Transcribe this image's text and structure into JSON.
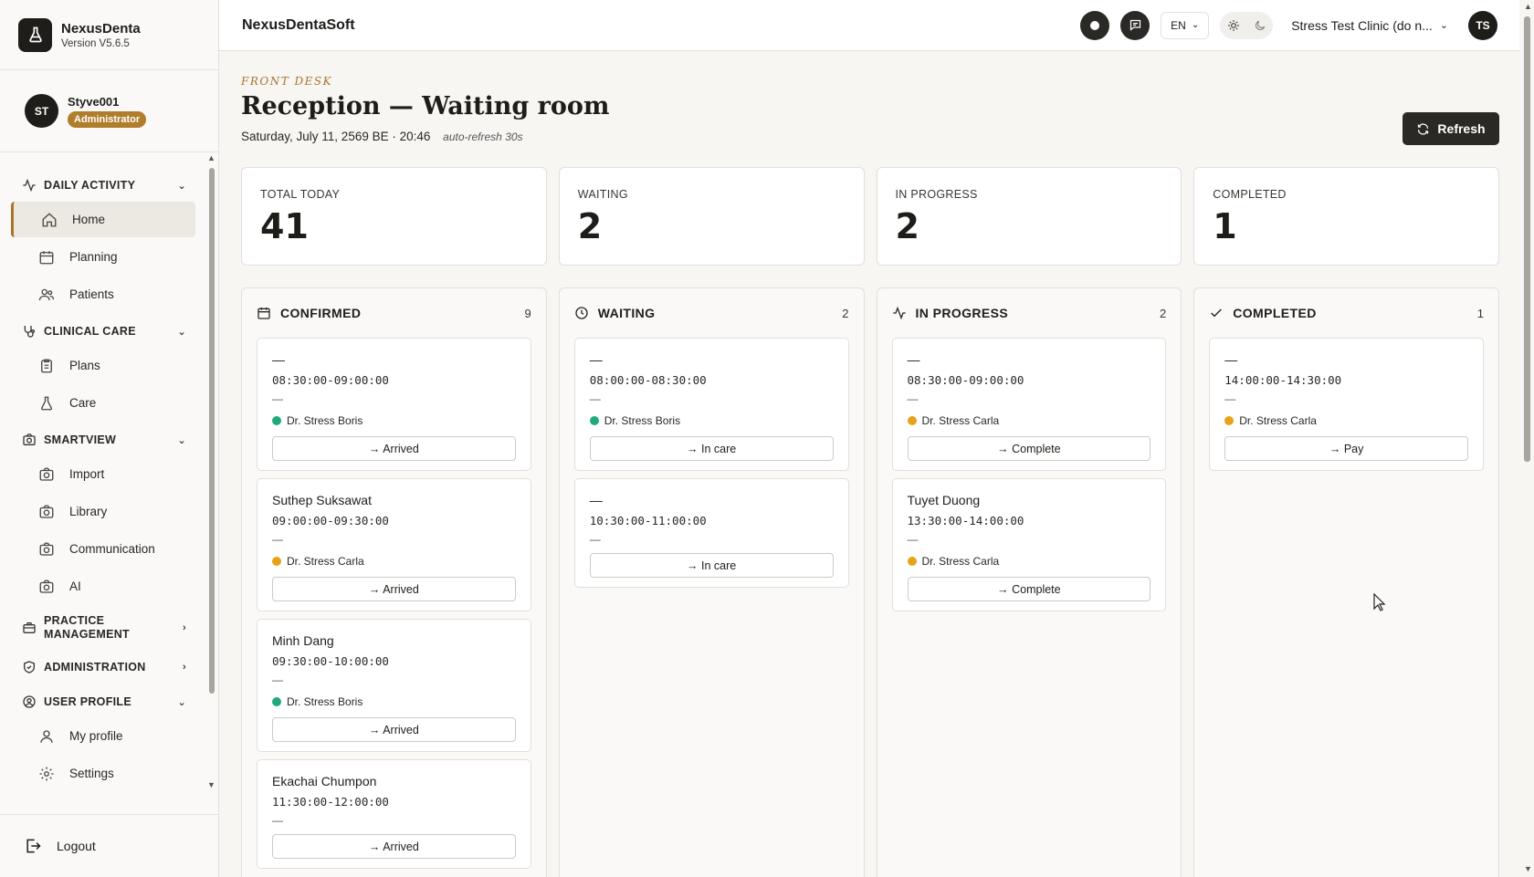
{
  "brand": {
    "name": "NexusDenta",
    "version": "Version V5.6.5"
  },
  "user": {
    "initials": "ST",
    "name": "Styve001",
    "role": "Administrator"
  },
  "nav": {
    "daily_activity": "DAILY ACTIVITY",
    "home": "Home",
    "planning": "Planning",
    "patients": "Patients",
    "clinical_care": "CLINICAL CARE",
    "plans": "Plans",
    "care": "Care",
    "smartview": "SMARTVIEW",
    "import": "Import",
    "library": "Library",
    "communication": "Communication",
    "ai": "AI",
    "practice_management": "PRACTICE MANAGEMENT",
    "administration": "ADMINISTRATION",
    "user_profile": "USER PROFILE",
    "my_profile": "My profile",
    "settings": "Settings",
    "logout": "Logout"
  },
  "topbar": {
    "app_title": "NexusDentaSoft",
    "lang": "EN",
    "clinic": "Stress Test Clinic (do n...",
    "avatar": "TS"
  },
  "page": {
    "eyebrow": "FRONT DESK",
    "title": "Reception — Waiting room",
    "date": "Saturday, July 11, 2569 BE · 20:46",
    "auto_refresh": "auto-refresh 30s",
    "refresh_label": "Refresh"
  },
  "stats": [
    {
      "label": "TOTAL TODAY",
      "value": "41"
    },
    {
      "label": "WAITING",
      "value": "2"
    },
    {
      "label": "IN PROGRESS",
      "value": "2"
    },
    {
      "label": "COMPLETED",
      "value": "1"
    }
  ],
  "columns": {
    "confirmed": {
      "title": "CONFIRMED",
      "count": "9",
      "cards": [
        {
          "name": "—",
          "time": "08:30:00-09:00:00",
          "sub": "—",
          "doctor": "Dr. Stress Boris",
          "action": "→ Arrived"
        },
        {
          "name": "Suthep Suksawat",
          "time": "09:00:00-09:30:00",
          "sub": "—",
          "doctor": "Dr. Stress Carla",
          "action": "→ Arrived"
        },
        {
          "name": "Minh Dang",
          "time": "09:30:00-10:00:00",
          "sub": "—",
          "doctor": "Dr. Stress Boris",
          "action": "→ Arrived"
        },
        {
          "name": "Ekachai Chumpon",
          "time": "11:30:00-12:00:00",
          "sub": "—",
          "action": "→ Arrived"
        }
      ]
    },
    "waiting": {
      "title": "WAITING",
      "count": "2",
      "cards": [
        {
          "name": "—",
          "time": "08:00:00-08:30:00",
          "sub": "—",
          "doctor": "Dr. Stress Boris",
          "action": "→ In care"
        },
        {
          "name": "—",
          "time": "10:30:00-11:00:00",
          "sub": "—",
          "action": "→ In care"
        }
      ]
    },
    "in_progress": {
      "title": "IN PROGRESS",
      "count": "2",
      "cards": [
        {
          "name": "—",
          "time": "08:30:00-09:00:00",
          "sub": "—",
          "doctor": "Dr. Stress Carla",
          "action": "→ Complete"
        },
        {
          "name": "Tuyet Duong",
          "time": "13:30:00-14:00:00",
          "sub": "—",
          "doctor": "Dr. Stress Carla",
          "action": "→ Complete"
        }
      ]
    },
    "completed": {
      "title": "COMPLETED",
      "count": "1",
      "cards": [
        {
          "name": "—",
          "time": "14:00:00-14:30:00",
          "sub": "—",
          "doctor": "Dr. Stress Carla",
          "action": "→ Pay"
        }
      ]
    }
  },
  "colors": {
    "accent": "#a9752a",
    "boris": "#22a97a",
    "carla": "#e8a21a",
    "dark": "#2b2926"
  }
}
